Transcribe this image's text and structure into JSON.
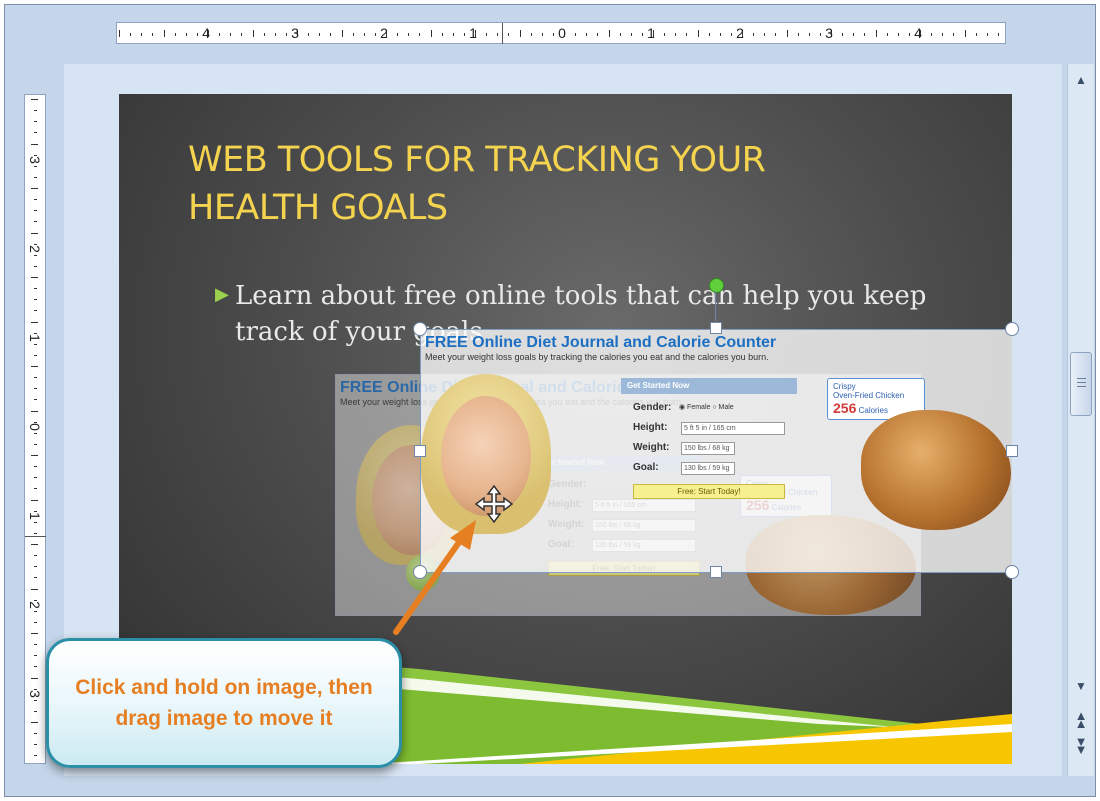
{
  "colors": {
    "title": "#f4d34f",
    "accent_green": "#9bd14e",
    "tooltip_text": "#e67e22",
    "web_title": "#1c6fc2"
  },
  "ruler": {
    "h_labels": [
      "4",
      "3",
      "2",
      "1",
      "0",
      "1",
      "2",
      "3",
      "4"
    ],
    "v_labels": [
      "3",
      "2",
      "1",
      "0",
      "1",
      "2",
      "3"
    ]
  },
  "slide": {
    "title_line1": "WEB TOOLS FOR TRACKING YOUR",
    "title_line2": "HEALTH GOALS",
    "bullet": "Learn about free online tools that can help you keep track of your goals"
  },
  "image": {
    "heading": "FREE Online Diet Journal and Calorie Counter",
    "subheading": "Meet your weight loss goals by tracking the calories you eat and the calories you burn.",
    "get_started": "Get Started Now",
    "gender_label": "Gender:",
    "gender_options": "◉ Female  ○ Male",
    "height_label": "Height:",
    "height_value": "5 ft 5 in / 165 cm",
    "weight_label": "Weight:",
    "weight_value": "150 lbs / 68 kg",
    "goal_label": "Goal:",
    "goal_value": "130 lbs / 59 kg",
    "start_button": "Free: Start Today!",
    "callout_line1": "Crispy",
    "callout_line2": "Oven-Fried Chicken",
    "callout_calories": "256",
    "callout_unit": "Calories"
  },
  "tooltip": {
    "text": "Click and hold on image, then drag image to move it"
  },
  "icons": {
    "move_cursor": "move-arrows-icon",
    "scroll_up": "scroll-up-icon",
    "scroll_down": "scroll-down-icon",
    "prev_slide": "previous-slide-icon",
    "next_slide": "next-slide-icon"
  }
}
